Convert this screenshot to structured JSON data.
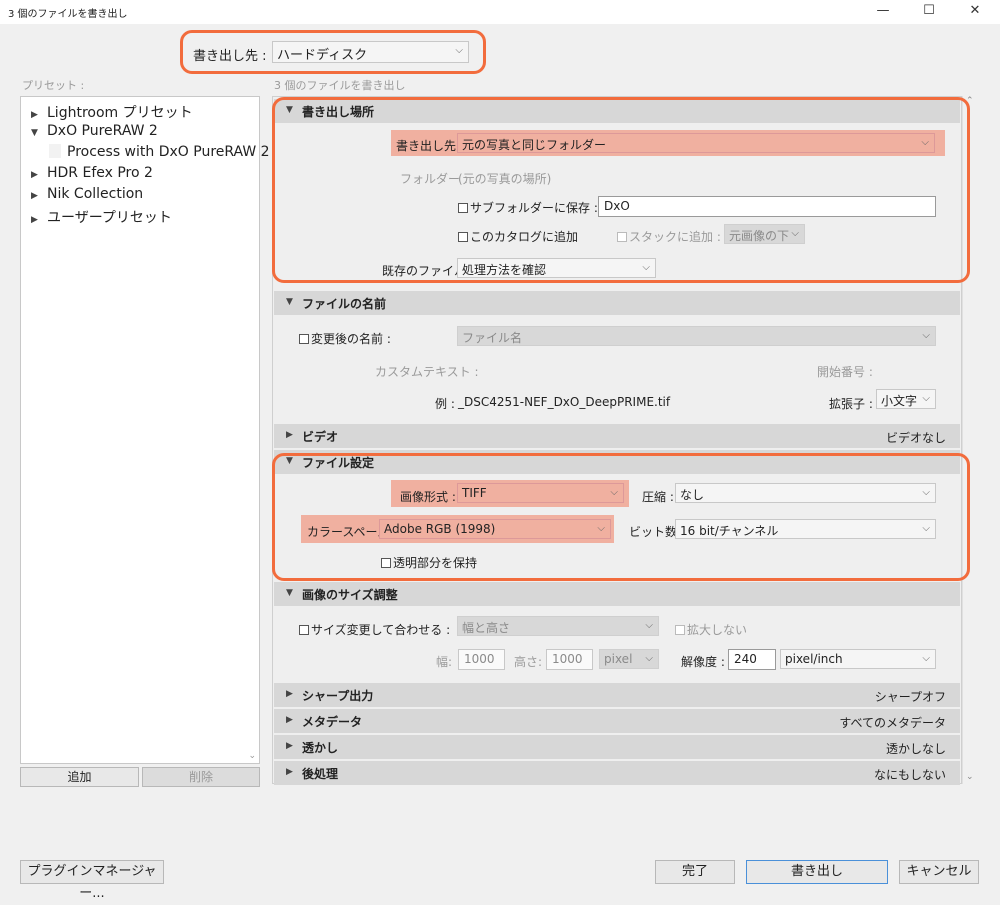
{
  "window": {
    "title": "3 個のファイルを書き出し",
    "minimize": "—",
    "maximize": "☐",
    "close": "✕"
  },
  "export_to": {
    "label": "書き出し先 :",
    "value": "ハードディスク"
  },
  "presets": {
    "heading": "プリセット :",
    "items": [
      {
        "label": "Lightroom プリセット",
        "expanded": false
      },
      {
        "label": "DxO PureRAW 2",
        "expanded": true
      },
      {
        "label": "Process with DxO PureRAW 2",
        "child": true
      },
      {
        "label": "HDR Efex Pro 2",
        "expanded": false
      },
      {
        "label": "Nik Collection",
        "expanded": false
      },
      {
        "label": "ユーザープリセット",
        "expanded": false
      }
    ],
    "add_label": "追加",
    "remove_label": "削除"
  },
  "summary": "3 個のファイルを書き出し",
  "location": {
    "title": "書き出し場所",
    "export_to_label": "書き出し先 :",
    "export_to_value": "元の写真と同じフォルダー",
    "folder_label": "フォルダー :",
    "folder_value": "(元の写真の場所)",
    "subfolder_label": "サブフォルダーに保存 :",
    "subfolder_value": "DxO",
    "add_catalog_label": "このカタログに追加",
    "add_stack_label": "スタックに追加 :",
    "stack_value": "元画像の下",
    "existing_label": "既存のファイル :",
    "existing_value": "処理方法を確認"
  },
  "naming": {
    "title": "ファイルの名前",
    "rename_label": "変更後の名前 :",
    "rename_value": "ファイル名",
    "custom_text_label": "カスタムテキスト :",
    "start_number_label": "開始番号 :",
    "example_label": "例 :",
    "example_value": "_DSC4251-NEF_DxO_DeepPRIME.tif",
    "extension_label": "拡張子 :",
    "extension_value": "小文字"
  },
  "video": {
    "title": "ビデオ",
    "summary": "ビデオなし"
  },
  "file_settings": {
    "title": "ファイル設定",
    "format_label": "画像形式 :",
    "format_value": "TIFF",
    "compression_label": "圧縮 :",
    "compression_value": "なし",
    "colorspace_label": "カラースペース :",
    "colorspace_value": "Adobe RGB (1998)",
    "bitdepth_label": "ビット数 :",
    "bitdepth_value": "16 bit/チャンネル",
    "transparency_label": "透明部分を保持"
  },
  "sizing": {
    "title": "画像のサイズ調整",
    "resize_label": "サイズ変更して合わせる :",
    "resize_value": "幅と高さ",
    "dont_enlarge_label": "拡大しない",
    "width_label": "幅:",
    "width_value": "1000",
    "height_label": "高さ:",
    "height_value": "1000",
    "unit_value": "pixel",
    "resolution_label": "解像度 :",
    "resolution_value": "240",
    "resolution_unit": "pixel/inch"
  },
  "sharpening": {
    "title": "シャープ出力",
    "summary": "シャープオフ"
  },
  "metadata": {
    "title": "メタデータ",
    "summary": "すべてのメタデータ"
  },
  "watermark": {
    "title": "透かし",
    "summary": "透かしなし"
  },
  "post_processing": {
    "title": "後処理",
    "summary": "なにもしない"
  },
  "footer": {
    "plugin_manager": "プラグインマネージャー...",
    "done": "完了",
    "export": "書き出し",
    "cancel": "キャンセル"
  },
  "colors": {
    "highlight": "#f0b0a0",
    "annotation": "#f26c3d",
    "section_header": "#d7d7d7"
  }
}
